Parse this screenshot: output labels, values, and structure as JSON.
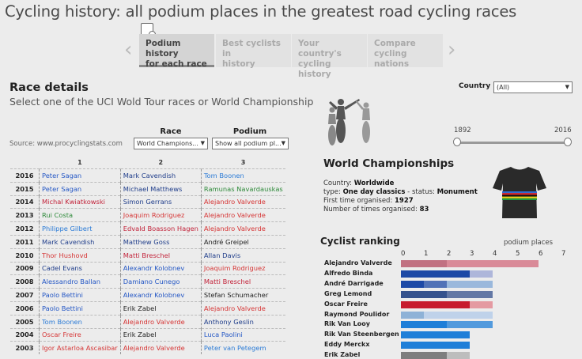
{
  "title": "Cycling history: all podium places in the greatest road cycling races",
  "story": {
    "tabs": [
      {
        "line1": "Podium history",
        "line2": "for each race"
      },
      {
        "line1": "Best cyclists in",
        "line2": "history"
      },
      {
        "line1": "Your country's",
        "line2": "cycling history"
      },
      {
        "line1": "Compare cycling",
        "line2": "nations"
      }
    ],
    "prev_arrow": "‹",
    "next_arrow": "›"
  },
  "race_details": {
    "title": "Race details",
    "subtitle": "Select one of the UCI Wold Tour races or World Championship",
    "source": "Source: www.procyclingstats.com",
    "race_label": "Race",
    "race_value": "World Champions...",
    "podium_label": "Podium",
    "podium_value": "Show all podium pl..."
  },
  "podium_table": {
    "headers": [
      "",
      "1",
      "2",
      "3"
    ],
    "rows": [
      {
        "year": "2016",
        "p1": "Peter Sagan",
        "p2": "Mark Cavendish",
        "p3": "Tom Boonen",
        "c1": "#2457c5",
        "c2": "#1f3d8a",
        "c3": "#2b7bd6"
      },
      {
        "year": "2015",
        "p1": "Peter Sagan",
        "p2": "Michael Matthews",
        "p3": "Ramunas Navardauskas",
        "c1": "#2457c5",
        "c2": "#1f3d8a",
        "c3": "#2e8a3a"
      },
      {
        "year": "2014",
        "p1": "Michal Kwiatkowski",
        "p2": "Simon Gerrans",
        "p3": "Alejandro Valverde",
        "c1": "#c2233a",
        "c2": "#1f3d8a",
        "c3": "#d63636"
      },
      {
        "year": "2013",
        "p1": "Rui Costa",
        "p2": "Joaquim Rodriguez",
        "p3": "Alejandro Valverde",
        "c1": "#2e8a3a",
        "c2": "#d63636",
        "c3": "#d63636"
      },
      {
        "year": "2012",
        "p1": "Philippe Gilbert",
        "p2": "Edvald Boasson Hagen",
        "p3": "Alejandro Valverde",
        "c1": "#2b7bd6",
        "c2": "#c2233a",
        "c3": "#d63636"
      },
      {
        "year": "2011",
        "p1": "Mark Cavendish",
        "p2": "Matthew Goss",
        "p3": "André Greipel",
        "c1": "#1f3d8a",
        "c2": "#1f3d8a",
        "c3": "#222222"
      },
      {
        "year": "2010",
        "p1": "Thor Hushovd",
        "p2": "Matti Breschel",
        "p3": "Allan Davis",
        "c1": "#d63636",
        "c2": "#c2233a",
        "c3": "#1f3d8a"
      },
      {
        "year": "2009",
        "p1": "Cadel Evans",
        "p2": "Alexandr Kolobnev",
        "p3": "Joaquim Rodriguez",
        "c1": "#1f3d8a",
        "c2": "#2457c5",
        "c3": "#d63636"
      },
      {
        "year": "2008",
        "p1": "Alessandro Ballan",
        "p2": "Damiano Cunego",
        "p3": "Matti Breschel",
        "c1": "#2457c5",
        "c2": "#2457c5",
        "c3": "#c2233a"
      },
      {
        "year": "2007",
        "p1": "Paolo Bettini",
        "p2": "Alexandr Kolobnev",
        "p3": "Stefan Schumacher",
        "c1": "#2457c5",
        "c2": "#2457c5",
        "c3": "#222222"
      },
      {
        "year": "2006",
        "p1": "Paolo Bettini",
        "p2": "Erik Zabel",
        "p3": "Alejandro Valverde",
        "c1": "#2457c5",
        "c2": "#222222",
        "c3": "#d63636"
      },
      {
        "year": "2005",
        "p1": "Tom Boonen",
        "p2": "Alejandro Valverde",
        "p3": "Anthony Geslin",
        "c1": "#2b7bd6",
        "c2": "#d63636",
        "c3": "#1f3d8a"
      },
      {
        "year": "2004",
        "p1": "Oscar Freire",
        "p2": "Erik Zabel",
        "p3": "Luca Paolini",
        "c1": "#d63636",
        "c2": "#222222",
        "c3": "#2457c5"
      },
      {
        "year": "2003",
        "p1": "Igor Astarloa Ascasibar",
        "p2": "Alejandro Valverde",
        "p3": "Peter van Petegem",
        "c1": "#d63636",
        "c2": "#d63636",
        "c3": "#2b7bd6"
      }
    ]
  },
  "filters": {
    "country_label": "Country",
    "country_value": "(All)",
    "year_start": "1892",
    "year_end": "2016"
  },
  "race_info": {
    "title": "World Championships",
    "country_label": "Country:",
    "country": "Worldwide",
    "type_label": "type:",
    "type": "One day classics",
    "status_label": "status:",
    "status": "Monument",
    "first_label": "First time organised:",
    "first": "1927",
    "times_label": "Number of times organised:",
    "times": "83",
    "separator": "-"
  },
  "ranking": {
    "title": "Cyclist ranking",
    "axis_label": "podium places",
    "ticks": [
      "0",
      "1",
      "2",
      "3",
      "4",
      "5",
      "6",
      "7"
    ],
    "cyclists": [
      {
        "name": "Alejandro Valverde",
        "first": 0,
        "second": 2,
        "third": 4,
        "c_dark": "#b3475d",
        "c_light": "#d98a98"
      },
      {
        "name": "Alfredo Binda",
        "first": 3,
        "second": 0,
        "third": 1,
        "c_dark": "#1d49a6",
        "c_light": "#aeb6da"
      },
      {
        "name": "André Darrigade",
        "first": 1,
        "second": 1,
        "third": 2,
        "c_dark": "#1d49a6",
        "c_light": "#9ab8dc"
      },
      {
        "name": "Greg Lemond",
        "first": 2,
        "second": 2,
        "third": 0,
        "c_dark": "#35528d",
        "c_light": "#5d73a8"
      },
      {
        "name": "Oscar Freire",
        "first": 3,
        "second": 0,
        "third": 1,
        "c_dark": "#c71c2e",
        "c_light": "#e49aa2"
      },
      {
        "name": "Raymond Poulidor",
        "first": 0,
        "second": 1,
        "third": 3,
        "c_dark": "#6f9fd0",
        "c_light": "#bfd2ea"
      },
      {
        "name": "Rik Van Looy",
        "first": 2,
        "second": 2,
        "third": 0,
        "c_dark": "#1f7fd8",
        "c_light": "#5aa6ea"
      },
      {
        "name": "Rik Van Steenbergen",
        "first": 3,
        "second": 0,
        "third": 0,
        "c_dark": "#1f7fd8",
        "c_light": "#5aa6ea"
      },
      {
        "name": "Eddy Merckx",
        "first": 3,
        "second": 0,
        "third": 0,
        "c_dark": "#1f7fd8",
        "c_light": "#5aa6ea"
      },
      {
        "name": "Erik Zabel",
        "first": 0,
        "second": 2,
        "third": 1,
        "c_dark": "#5a5a5a",
        "c_light": "#bdbdbd"
      }
    ]
  },
  "colors": {
    "background": "#ececec",
    "active_tab": "#d4d4d4"
  }
}
